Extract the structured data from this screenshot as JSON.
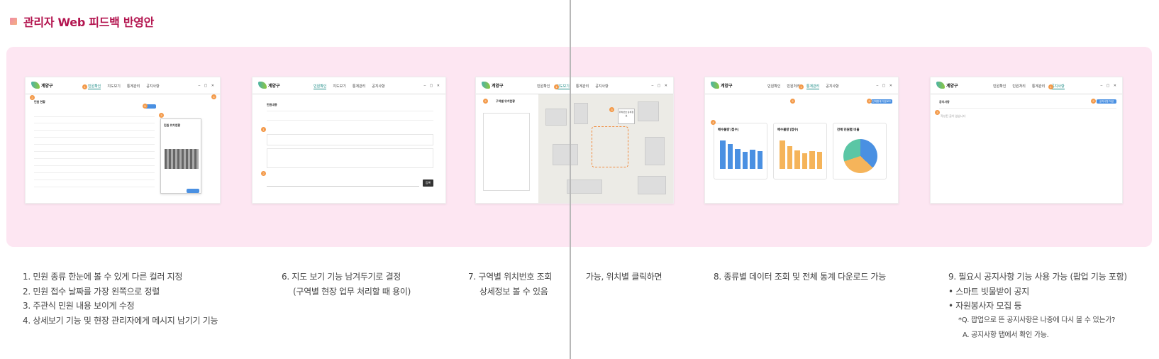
{
  "header": {
    "title": "관리자 Web 피드백 반영안",
    "accent_color": "#b3144f"
  },
  "screens": {
    "s1": {
      "logo": "계양구",
      "nav": [
        "민원확인",
        "지도보기",
        "통계관리",
        "공지사항"
      ],
      "section_title": "민원 현황",
      "popup_title": "민원 위치현황",
      "badges": [
        "1",
        "2",
        "3",
        "4",
        "5"
      ]
    },
    "s2": {
      "logo": "계양구",
      "nav": [
        "민원확인",
        "지도보기",
        "통계관리",
        "공지사항"
      ],
      "section_title": "민원내용",
      "badges": [
        "1",
        "2"
      ],
      "save_label": "등록"
    },
    "s3": {
      "logo": "계양구",
      "nav": [
        "민원확인",
        "지도보기",
        "통계관리",
        "공지사항"
      ],
      "list_title": "구역별 위치현황",
      "callout": "위치번호 상세정보",
      "badges": [
        "1",
        "2",
        "3"
      ]
    },
    "s4": {
      "logo": "계양구",
      "nav": [
        "민원확인",
        "민원처리",
        "통계관리",
        "공지사항"
      ],
      "download_label": "전체통계 다운로드",
      "badges": [
        "1",
        "2",
        "3",
        "4"
      ],
      "cards": [
        {
          "title": "배수불량 (접수)",
          "color": "#4a90e2",
          "values": [
            30,
            26,
            21,
            18,
            20,
            19
          ]
        },
        {
          "title": "배수불량 (접수)",
          "color": "#f5b45a",
          "values": [
            34,
            27,
            22,
            19,
            21,
            20
          ]
        },
        {
          "title": "전체 민원별 비율",
          "slices": [
            37,
            33,
            30
          ]
        }
      ]
    },
    "s5": {
      "logo": "계양구",
      "nav": [
        "민원확인",
        "민원처리",
        "통계관리",
        "공지사항"
      ],
      "section_title": "공지사항",
      "write_label": "공지사항 작성",
      "empty_text": "작성된 글이 없습니다",
      "badges": [
        "1",
        "2",
        "3"
      ]
    }
  },
  "notes": {
    "col1": [
      "1. 민원 종류 한눈에 볼 수 있게 다른 컬러 지정",
      "2. 민원 접수 날짜를 가장 왼쪽으로 정렬",
      "3. 주관식 민원 내용 보이게 수정",
      "4. 상세보기 기능 및 현장 관리자에게 메시지 남기기 기능"
    ],
    "col2": [
      "6. 지도 보기 기능 남겨두기로 결정",
      "(구역별 현장 업무 처리할 때 용이)"
    ],
    "col3": [
      "7. 구역별 위치번호 조회",
      "상세정보 볼 수 있음"
    ],
    "col3b": [
      "가능, 위치별 클릭하면"
    ],
    "col4": [
      "8. 종류별 데이터 조회 및 전체 통계 다운로드 가능"
    ],
    "col5": [
      "9. 필요시 공지사항 기능 사용 가능 (팝업 기능 포함)",
      "•  스마트 빗물받이 공지",
      "•  자원봉사자 모집 등"
    ],
    "col5_small": [
      "*Q. 팝업으로 뜬 공지사항은 나중에 다시 볼 수 있는가?",
      "A. 공지사항 탭에서 확인 가능."
    ]
  }
}
